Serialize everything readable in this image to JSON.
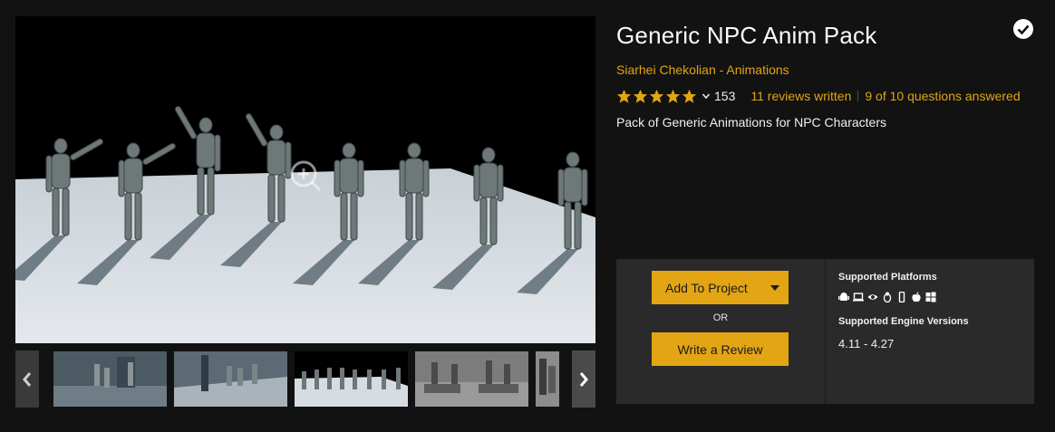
{
  "product": {
    "title": "Generic NPC Anim Pack",
    "author": "Siarhei Chekolian",
    "author_separator": " - ",
    "category": "Animations",
    "rating_stars": 5,
    "rating_count": "153",
    "reviews_link": "11 reviews written",
    "questions_link": "9 of 10 questions answered",
    "description": "Pack of Generic Animations for NPC Characters"
  },
  "purchase": {
    "add_to_project": "Add To Project",
    "or_label": "OR",
    "write_review": "Write a Review"
  },
  "specs": {
    "platforms_title": "Supported Platforms",
    "platforms": [
      "android-icon",
      "windows-pc-icon",
      "vr-eye-icon",
      "linux-icon",
      "mobile-icon",
      "apple-icon",
      "windows-icon"
    ],
    "engine_title": "Supported Engine Versions",
    "engine_versions": "4.11 - 4.27"
  },
  "gallery": {
    "thumbnails": 5,
    "selected_thumbnail": 3
  },
  "colors": {
    "accent": "#e3a513",
    "background": "#121212",
    "panel": "#2a2a2a"
  }
}
